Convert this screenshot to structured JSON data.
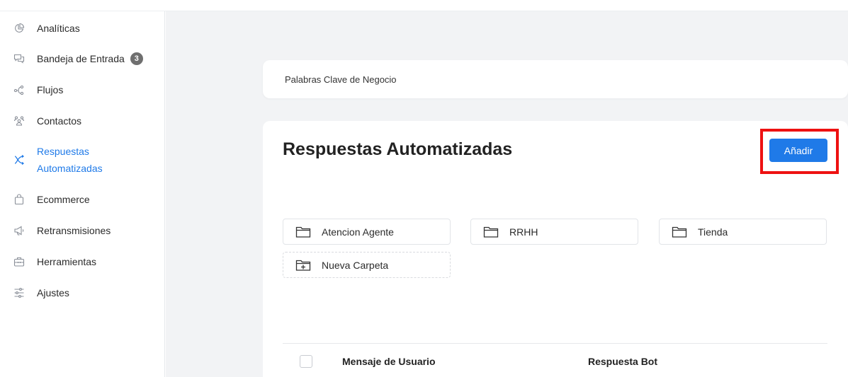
{
  "sidebar": {
    "items": [
      {
        "label": "Analíticas",
        "icon": "pie-chart-icon"
      },
      {
        "label": "Bandeja de Entrada",
        "icon": "chat-bubbles-icon",
        "badge": "3"
      },
      {
        "label": "Flujos",
        "icon": "flow-nodes-icon"
      },
      {
        "label": "Contactos",
        "icon": "users-icon"
      },
      {
        "label": "Respuestas Automatizadas",
        "label_line1": "Respuestas",
        "label_line2": "Automatizadas",
        "icon": "auto-reply-icon",
        "active": true
      },
      {
        "label": "Ecommerce",
        "icon": "shopping-bag-icon"
      },
      {
        "label": "Retransmisiones",
        "icon": "megaphone-icon"
      },
      {
        "label": "Herramientas",
        "icon": "toolbox-icon"
      },
      {
        "label": "Ajustes",
        "icon": "sliders-icon"
      }
    ]
  },
  "main": {
    "keywords_card": {
      "label": "Palabras Clave de Negocio"
    },
    "title": "Respuestas Automatizadas",
    "add_button": "Añadir",
    "folders": [
      {
        "label": "Atencion Agente",
        "icon": "folder-icon"
      },
      {
        "label": "RRHH",
        "icon": "folder-icon"
      },
      {
        "label": "Tienda",
        "icon": "folder-icon"
      },
      {
        "label": "Nueva Carpeta",
        "icon": "folder-plus-icon"
      }
    ],
    "table": {
      "columns": [
        "Mensaje de Usuario",
        "Respuesta Bot"
      ]
    }
  },
  "colors": {
    "accent": "#1f7ae8",
    "highlight": "#ee1111",
    "badge": "#6f6f6f",
    "background": "#f2f3f5"
  }
}
